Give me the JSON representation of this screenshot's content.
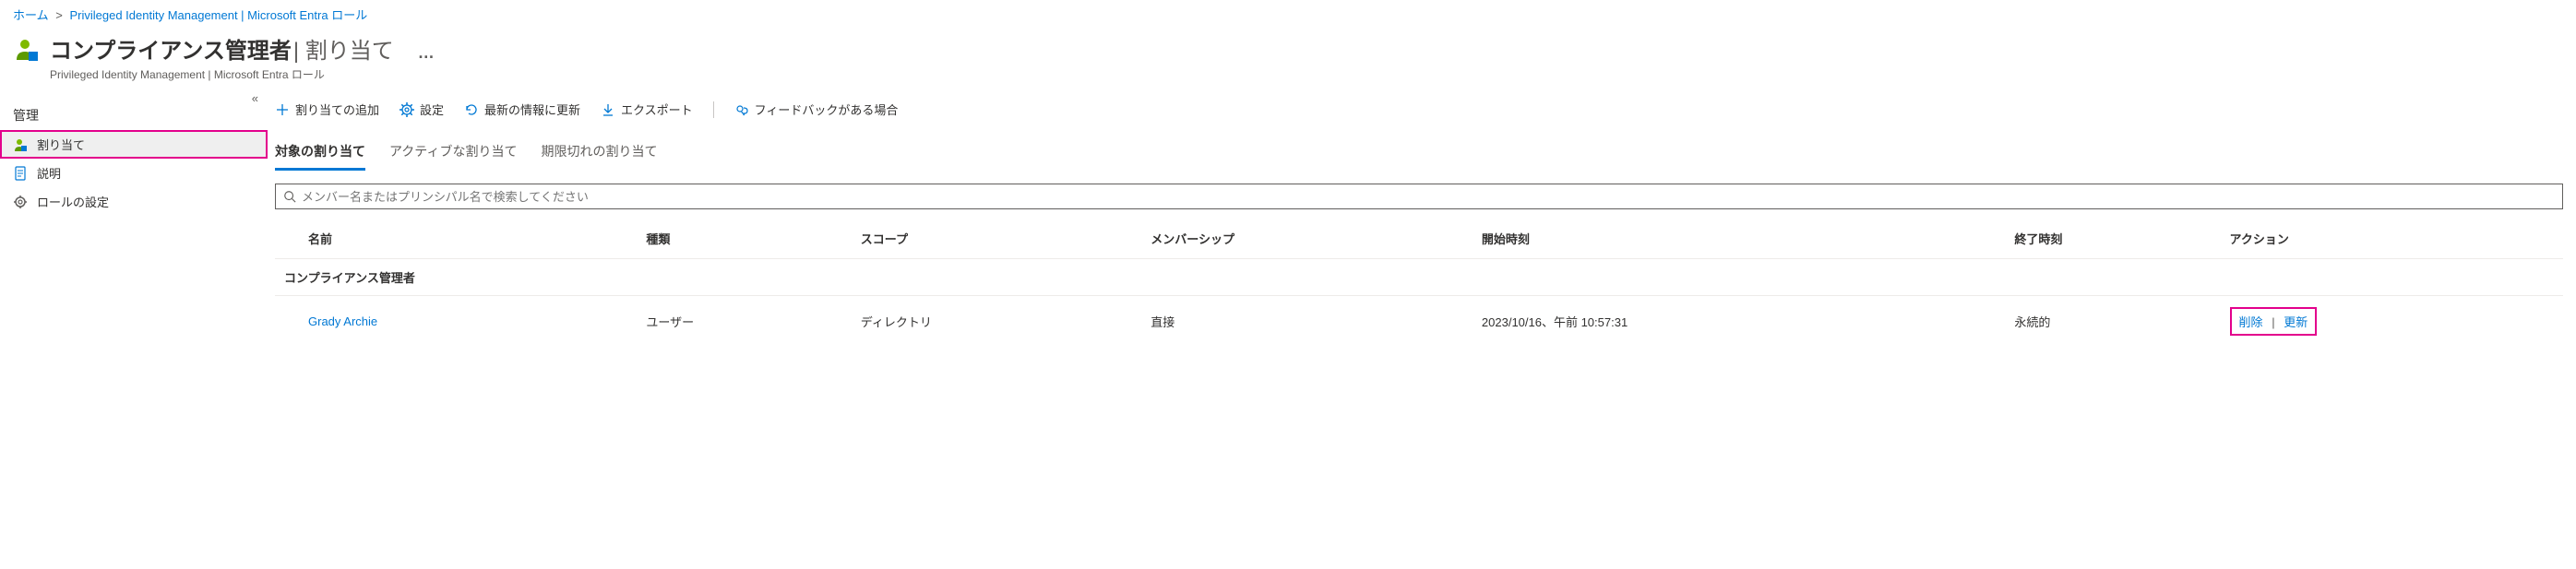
{
  "breadcrumb": {
    "home": "ホーム",
    "link": "Privileged Identity Management | Microsoft Entra ロール"
  },
  "header": {
    "title_strong": "コンプライアンス管理者",
    "title_light": " | 割り当て",
    "ellipsis": "…",
    "subtitle": "Privileged Identity Management | Microsoft Entra ロール"
  },
  "sidebar": {
    "group_label": "管理",
    "items": [
      {
        "label": "割り当て"
      },
      {
        "label": "説明"
      },
      {
        "label": "ロールの設定"
      }
    ]
  },
  "toolbar": {
    "add": "割り当ての追加",
    "settings": "設定",
    "refresh": "最新の情報に更新",
    "export": "エクスポート",
    "feedback": "フィードバックがある場合"
  },
  "tabs": {
    "eligible": "対象の割り当て",
    "active": "アクティブな割り当て",
    "expired": "期限切れの割り当て"
  },
  "search": {
    "placeholder": "メンバー名またはプリンシパル名で検索してください"
  },
  "table": {
    "headers": {
      "name": "名前",
      "type": "種類",
      "scope": "スコープ",
      "membership": "メンバーシップ",
      "start": "開始時刻",
      "end": "終了時刻",
      "action": "アクション"
    },
    "group": "コンプライアンス管理者",
    "row": {
      "name": "Grady Archie",
      "type": "ユーザー",
      "scope": "ディレクトリ",
      "membership": "直接",
      "start": "2023/10/16、午前 10:57:31",
      "end": "永続的",
      "action_remove": "削除",
      "action_sep": "|",
      "action_update": "更新"
    }
  }
}
